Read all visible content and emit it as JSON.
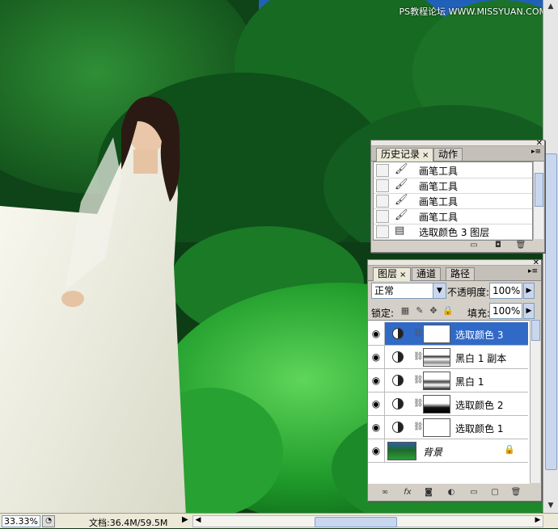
{
  "watermark": "PS教程论坛 WWW.MISSYUAN.COM",
  "status": {
    "zoom": "33.33%",
    "doc_info": "文档:36.4M/59.5M"
  },
  "history_panel": {
    "tabs": [
      {
        "label": "历史记录"
      },
      {
        "label": "动作"
      }
    ],
    "items": [
      {
        "label": "画笔工具",
        "icon": "brush-icon"
      },
      {
        "label": "画笔工具",
        "icon": "brush-icon"
      },
      {
        "label": "画笔工具",
        "icon": "brush-icon"
      },
      {
        "label": "画笔工具",
        "icon": "brush-icon"
      },
      {
        "label": "选取颜色 3 图层",
        "icon": "adjustment-layer-icon"
      }
    ]
  },
  "layers_panel": {
    "tabs": [
      {
        "label": "图层"
      },
      {
        "label": "通道"
      },
      {
        "label": "路径"
      }
    ],
    "blend_mode": "正常",
    "opacity_label": "不透明度:",
    "opacity": "100%",
    "lock_label": "锁定:",
    "fill_label": "填充:",
    "fill": "100%",
    "layers": [
      {
        "name": "选取颜色 3",
        "selected": true
      },
      {
        "name": "黑白 1 副本",
        "selected": false
      },
      {
        "name": "黑白 1",
        "selected": false
      },
      {
        "name": "选取颜色 2",
        "selected": false
      },
      {
        "name": "选取颜色 1",
        "selected": false
      },
      {
        "name": "背景",
        "selected": false,
        "locked": true
      }
    ],
    "footer_icons": [
      "link-icon",
      "fx-icon",
      "mask-icon",
      "adjustment-icon",
      "group-icon",
      "new-layer-icon",
      "trash-icon"
    ]
  },
  "colors": {
    "selection": "#3169c6",
    "panel_bg": "#d4d0c8"
  }
}
